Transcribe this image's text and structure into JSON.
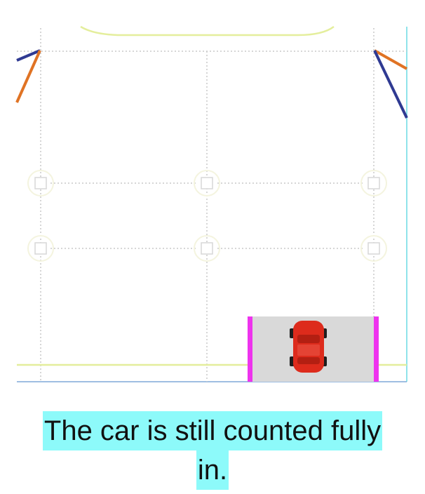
{
  "caption": {
    "line1": "The car is still counted fully",
    "line2": "in."
  },
  "colors": {
    "grid_line": "#c9c9c9",
    "lane_line": "#e4ee9c",
    "node_ring": "#f4f4df",
    "node_box": "#d7d7d7",
    "zone_fill": "#d9d9d9",
    "zone_edge": "#ee33ee",
    "car_body": "#dd2b1c",
    "car_wheel": "#1e1e1e",
    "ray_blue": "#2f3a92",
    "ray_orange": "#e07324",
    "frame_right": "#8fe3ea",
    "frame_bottom": "#7fa9d8",
    "caption_highlight": "#8dfafa"
  },
  "icons": {
    "car": "car-icon",
    "node": "square-node-icon"
  }
}
